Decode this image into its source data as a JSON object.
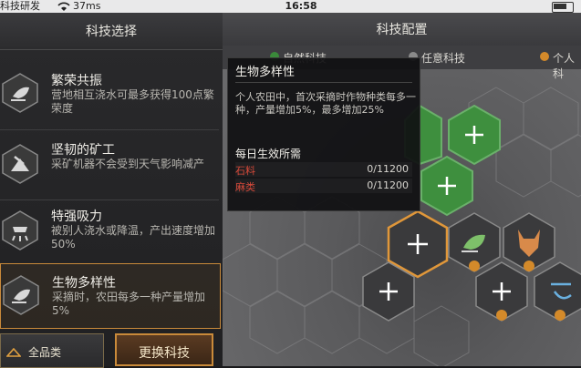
{
  "statusbar": {
    "carrier": "科技研发",
    "latency": "37ms",
    "time": "16:58"
  },
  "left_panel": {
    "title": "科技选择",
    "skills": [
      {
        "name": "繁荣共振",
        "desc": "营地相互浇水可最多获得100点繁荣度",
        "icon": "leaf-hand-icon"
      },
      {
        "name": "坚韧的矿工",
        "desc": "采矿机器不会受到天气影响减产",
        "icon": "mining-icon"
      },
      {
        "name": "特强吸力",
        "desc": "被别人浇水或降温，产出速度增加50%",
        "icon": "sprinkler-icon"
      },
      {
        "name": "生物多样性",
        "desc": "采摘时，农田每多一种产量增加5%",
        "icon": "leaf-hand-icon"
      }
    ],
    "filter_button": "全品类",
    "swap_button": "更换科技"
  },
  "right_panel": {
    "title": "科技配置",
    "filters": [
      "自然科技",
      "任意科技",
      "个人科"
    ],
    "colors": {
      "natural": "#3a8a3a",
      "any": "#7a7a7a",
      "personal": "#d48a2a",
      "accent": "#c98a3a",
      "hex_green": "#3e8f3e"
    }
  },
  "tooltip": {
    "title": "生物多样性",
    "desc": "个人农田中，首次采摘时作物种类每多一种，产量增加5%，最多增加25%",
    "requirement_title": "每日生效所需",
    "rows": [
      {
        "name": "石料",
        "value": "0/11200"
      },
      {
        "name": "麻类",
        "value": "0/11200"
      }
    ]
  }
}
